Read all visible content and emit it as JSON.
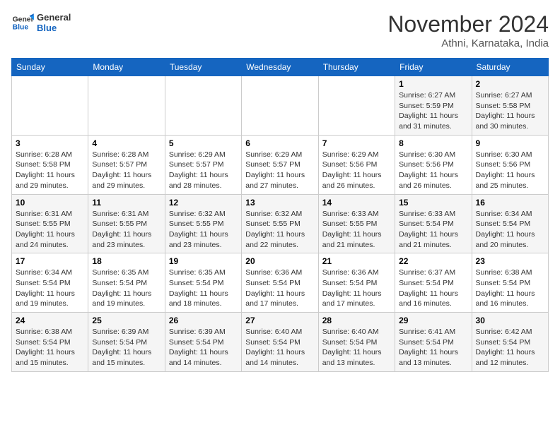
{
  "header": {
    "logo_line1": "General",
    "logo_line2": "Blue",
    "month_title": "November 2024",
    "subtitle": "Athni, Karnataka, India"
  },
  "weekdays": [
    "Sunday",
    "Monday",
    "Tuesday",
    "Wednesday",
    "Thursday",
    "Friday",
    "Saturday"
  ],
  "weeks": [
    [
      {
        "day": "",
        "info": ""
      },
      {
        "day": "",
        "info": ""
      },
      {
        "day": "",
        "info": ""
      },
      {
        "day": "",
        "info": ""
      },
      {
        "day": "",
        "info": ""
      },
      {
        "day": "1",
        "info": "Sunrise: 6:27 AM\nSunset: 5:59 PM\nDaylight: 11 hours and 31 minutes."
      },
      {
        "day": "2",
        "info": "Sunrise: 6:27 AM\nSunset: 5:58 PM\nDaylight: 11 hours and 30 minutes."
      }
    ],
    [
      {
        "day": "3",
        "info": "Sunrise: 6:28 AM\nSunset: 5:58 PM\nDaylight: 11 hours and 29 minutes."
      },
      {
        "day": "4",
        "info": "Sunrise: 6:28 AM\nSunset: 5:57 PM\nDaylight: 11 hours and 29 minutes."
      },
      {
        "day": "5",
        "info": "Sunrise: 6:29 AM\nSunset: 5:57 PM\nDaylight: 11 hours and 28 minutes."
      },
      {
        "day": "6",
        "info": "Sunrise: 6:29 AM\nSunset: 5:57 PM\nDaylight: 11 hours and 27 minutes."
      },
      {
        "day": "7",
        "info": "Sunrise: 6:29 AM\nSunset: 5:56 PM\nDaylight: 11 hours and 26 minutes."
      },
      {
        "day": "8",
        "info": "Sunrise: 6:30 AM\nSunset: 5:56 PM\nDaylight: 11 hours and 26 minutes."
      },
      {
        "day": "9",
        "info": "Sunrise: 6:30 AM\nSunset: 5:56 PM\nDaylight: 11 hours and 25 minutes."
      }
    ],
    [
      {
        "day": "10",
        "info": "Sunrise: 6:31 AM\nSunset: 5:55 PM\nDaylight: 11 hours and 24 minutes."
      },
      {
        "day": "11",
        "info": "Sunrise: 6:31 AM\nSunset: 5:55 PM\nDaylight: 11 hours and 23 minutes."
      },
      {
        "day": "12",
        "info": "Sunrise: 6:32 AM\nSunset: 5:55 PM\nDaylight: 11 hours and 23 minutes."
      },
      {
        "day": "13",
        "info": "Sunrise: 6:32 AM\nSunset: 5:55 PM\nDaylight: 11 hours and 22 minutes."
      },
      {
        "day": "14",
        "info": "Sunrise: 6:33 AM\nSunset: 5:55 PM\nDaylight: 11 hours and 21 minutes."
      },
      {
        "day": "15",
        "info": "Sunrise: 6:33 AM\nSunset: 5:54 PM\nDaylight: 11 hours and 21 minutes."
      },
      {
        "day": "16",
        "info": "Sunrise: 6:34 AM\nSunset: 5:54 PM\nDaylight: 11 hours and 20 minutes."
      }
    ],
    [
      {
        "day": "17",
        "info": "Sunrise: 6:34 AM\nSunset: 5:54 PM\nDaylight: 11 hours and 19 minutes."
      },
      {
        "day": "18",
        "info": "Sunrise: 6:35 AM\nSunset: 5:54 PM\nDaylight: 11 hours and 19 minutes."
      },
      {
        "day": "19",
        "info": "Sunrise: 6:35 AM\nSunset: 5:54 PM\nDaylight: 11 hours and 18 minutes."
      },
      {
        "day": "20",
        "info": "Sunrise: 6:36 AM\nSunset: 5:54 PM\nDaylight: 11 hours and 17 minutes."
      },
      {
        "day": "21",
        "info": "Sunrise: 6:36 AM\nSunset: 5:54 PM\nDaylight: 11 hours and 17 minutes."
      },
      {
        "day": "22",
        "info": "Sunrise: 6:37 AM\nSunset: 5:54 PM\nDaylight: 11 hours and 16 minutes."
      },
      {
        "day": "23",
        "info": "Sunrise: 6:38 AM\nSunset: 5:54 PM\nDaylight: 11 hours and 16 minutes."
      }
    ],
    [
      {
        "day": "24",
        "info": "Sunrise: 6:38 AM\nSunset: 5:54 PM\nDaylight: 11 hours and 15 minutes."
      },
      {
        "day": "25",
        "info": "Sunrise: 6:39 AM\nSunset: 5:54 PM\nDaylight: 11 hours and 15 minutes."
      },
      {
        "day": "26",
        "info": "Sunrise: 6:39 AM\nSunset: 5:54 PM\nDaylight: 11 hours and 14 minutes."
      },
      {
        "day": "27",
        "info": "Sunrise: 6:40 AM\nSunset: 5:54 PM\nDaylight: 11 hours and 14 minutes."
      },
      {
        "day": "28",
        "info": "Sunrise: 6:40 AM\nSunset: 5:54 PM\nDaylight: 11 hours and 13 minutes."
      },
      {
        "day": "29",
        "info": "Sunrise: 6:41 AM\nSunset: 5:54 PM\nDaylight: 11 hours and 13 minutes."
      },
      {
        "day": "30",
        "info": "Sunrise: 6:42 AM\nSunset: 5:54 PM\nDaylight: 11 hours and 12 minutes."
      }
    ]
  ]
}
